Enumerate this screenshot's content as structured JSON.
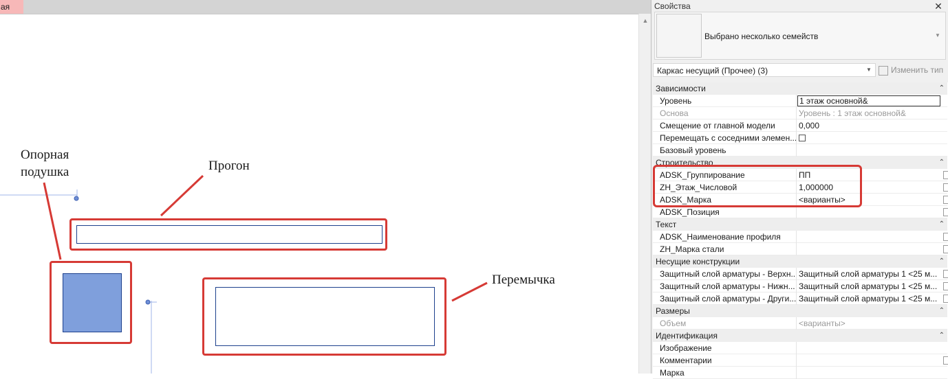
{
  "tab": {
    "label": "ая"
  },
  "callouts": {
    "pad": {
      "line1": "Опорная",
      "line2": "подушка"
    },
    "purlin": "Прогон",
    "lintel": "Перемычка"
  },
  "colors": {
    "highlight": "#d63a35",
    "element_fill": "#7f9fdc",
    "element_edge": "#1c3f8c"
  },
  "properties": {
    "title": "Свойства",
    "type_name": "Выбрано несколько семейств",
    "filter": "Каркас несущий (Прочее) (3)",
    "edit_type": "Изменить тип",
    "groups": {
      "constraints": "Зависимости",
      "construction": "Строительство",
      "text": "Текст",
      "structural": "Несущие конструкции",
      "dimensions": "Размеры",
      "identity": "Идентификация"
    },
    "rows": {
      "level": {
        "name": "Уровень",
        "value": "1 этаж основной&"
      },
      "host": {
        "name": "Основа",
        "value": "Уровень : 1 этаж основной&"
      },
      "offset": {
        "name": "Смещение от главной модели",
        "value": "0,000"
      },
      "move_with": {
        "name": "Перемещать с соседними элемен..."
      },
      "base_level": {
        "name": "Базовый уровень",
        "value": ""
      },
      "grouping": {
        "name": "ADSK_Группирование",
        "value": "ПП"
      },
      "floor_num": {
        "name": "ZH_Этаж_Числовой",
        "value": "1,000000"
      },
      "mark": {
        "name": "ADSK_Марка",
        "value": "<варианты>"
      },
      "position": {
        "name": "ADSK_Позиция",
        "value": ""
      },
      "profile_name": {
        "name": "ADSK_Наименование профиля",
        "value": ""
      },
      "steel_grade": {
        "name": "ZH_Марка стали",
        "value": ""
      },
      "cover_top": {
        "name": "Защитный слой арматуры - Верхн...",
        "value": "Защитный слой арматуры 1 <25 м..."
      },
      "cover_bottom": {
        "name": "Защитный слой арматуры - Нижн...",
        "value": "Защитный слой арматуры 1 <25 м..."
      },
      "cover_other": {
        "name": "Защитный слой арматуры - Други...",
        "value": "Защитный слой арматуры 1 <25 м..."
      },
      "volume": {
        "name": "Объем",
        "value": "<варианты>"
      },
      "image": {
        "name": "Изображение",
        "value": ""
      },
      "comments": {
        "name": "Комментарии",
        "value": ""
      },
      "mark2": {
        "name": "Марка",
        "value": ""
      }
    }
  }
}
